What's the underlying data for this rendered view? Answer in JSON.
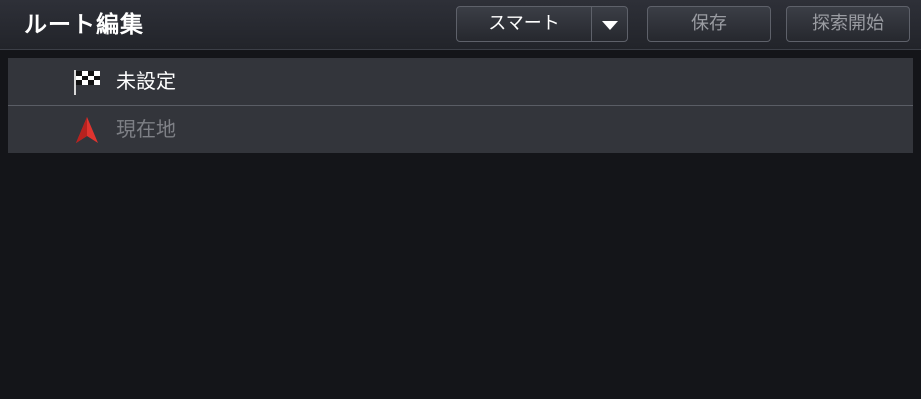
{
  "header": {
    "title": "ルート編集",
    "mode_label": "スマート",
    "save_label": "保存",
    "start_label": "探索開始"
  },
  "route": {
    "items": [
      {
        "label": "未設定",
        "icon": "checkered-flag-icon"
      },
      {
        "label": "現在地",
        "icon": "current-location-arrow-icon"
      }
    ]
  },
  "colors": {
    "background": "#141519",
    "header": "#2a2c32",
    "row": "#33353b",
    "arrow_accent": "#e0342f",
    "text": "#ffffff",
    "dim_text": "#7e8086"
  }
}
